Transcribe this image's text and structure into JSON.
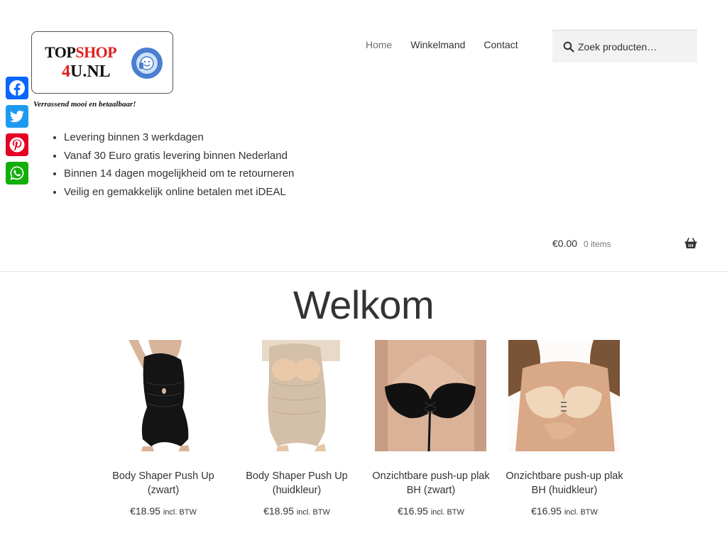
{
  "logo": {
    "line1_black": "TOP",
    "line1_red": "SHOP",
    "line2_red": "4",
    "line2_black": "U.NL",
    "tagline": "Verrassend mooi en betaalbaar!"
  },
  "nav": {
    "items": [
      {
        "label": "Home",
        "active": true
      },
      {
        "label": "Winkelmand",
        "active": false
      },
      {
        "label": "Contact",
        "active": false
      }
    ]
  },
  "search": {
    "placeholder": "Zoek producten…",
    "icon": "search-icon"
  },
  "share": {
    "items": [
      {
        "network": "Facebook",
        "color": "#0866ff",
        "icon": "facebook-icon"
      },
      {
        "network": "Twitter",
        "color": "#1d9bf0",
        "icon": "twitter-icon"
      },
      {
        "network": "Pinterest",
        "color": "#e60023",
        "icon": "pinterest-icon"
      },
      {
        "network": "WhatsApp",
        "color": "#12af0a",
        "icon": "whatsapp-icon"
      }
    ]
  },
  "usp": {
    "items": [
      "Levering binnen 3 werkdagen",
      "Vanaf 30 Euro gratis levering binnen Nederland",
      "Binnen 14 dagen mogelijkheid om te retourneren",
      "Veilig en gemakkelijk online betalen met iDEAL"
    ]
  },
  "cart": {
    "amount": "€0.00",
    "count": "0 items",
    "icon": "basket-icon"
  },
  "main": {
    "title": "Welkom"
  },
  "products": [
    {
      "name": "Body Shaper Push Up (zwart)",
      "price": "€18.95",
      "vat": "incl. BTW",
      "image": "black body shaper"
    },
    {
      "name": "Body Shaper Push Up (huidkleur)",
      "price": "€18.95",
      "vat": "incl. BTW",
      "image": "skin-colored body shaper"
    },
    {
      "name": "Onzichtbare push-up plak BH (zwart)",
      "price": "€16.95",
      "vat": "incl. BTW",
      "image": "black adhesive bra"
    },
    {
      "name": "Onzichtbare push-up plak BH (huidkleur)",
      "price": "€16.95",
      "vat": "incl. BTW",
      "image": "skin-colored adhesive bra"
    }
  ]
}
